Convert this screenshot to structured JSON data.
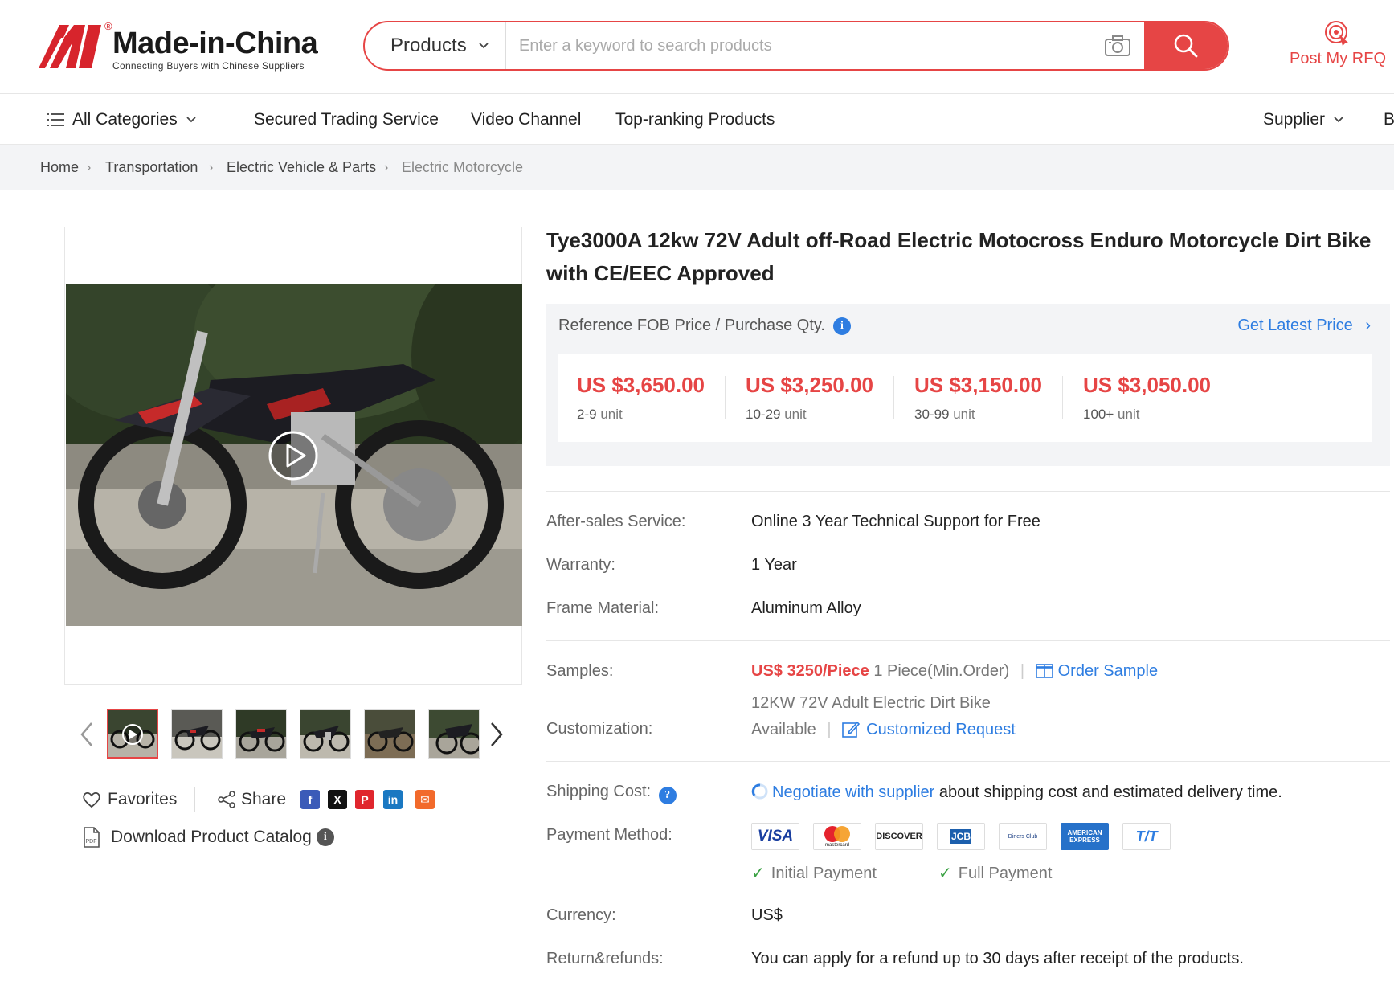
{
  "header": {
    "logo_text": "Made-in-China",
    "logo_reg": "®",
    "logo_sub": "Connecting Buyers with Chinese Suppliers",
    "search_type": "Products",
    "search_placeholder": "Enter a keyword to search products",
    "rfq_label": "Post My RFQ"
  },
  "nav": {
    "all_categories": "All Categories",
    "items": [
      "Secured Trading Service",
      "Video Channel",
      "Top-ranking Products"
    ],
    "supplier": "Supplier",
    "cut_item": "B"
  },
  "breadcrumb": [
    "Home",
    "Transportation",
    "Electric Vehicle & Parts",
    "Electric Motorcycle"
  ],
  "gallery": {
    "favorites": "Favorites",
    "share": "Share",
    "social": [
      "f",
      "X",
      "P",
      "in",
      "✉"
    ],
    "catalog": "Download Product Catalog",
    "pdf_label": "PDF"
  },
  "product": {
    "title": "Tye3000A 12kw 72V Adult off-Road Electric Motocross Enduro Motorcycle Dirt Bike with CE/EEC Approved",
    "price_header": "Reference FOB Price / Purchase Qty.",
    "get_latest": "Get Latest Price",
    "tiers": [
      {
        "price": "US $3,650.00",
        "qty": "2-9",
        "unit": "unit"
      },
      {
        "price": "US $3,250.00",
        "qty": "10-29",
        "unit": "unit"
      },
      {
        "price": "US $3,150.00",
        "qty": "30-99",
        "unit": "unit"
      },
      {
        "price": "US $3,050.00",
        "qty": "100+",
        "unit": "unit"
      }
    ],
    "specs": [
      {
        "label": "After-sales Service:",
        "value": "Online 3 Year Technical Support for Free"
      },
      {
        "label": "Warranty:",
        "value": "1 Year"
      },
      {
        "label": "Frame Material:",
        "value": "Aluminum Alloy"
      }
    ],
    "samples": {
      "label": "Samples:",
      "price": "US$ 3250/Piece",
      "moq": "1 Piece(Min.Order)",
      "action": "Order Sample"
    },
    "customization": {
      "label": "Customization:",
      "line1": "12KW 72V Adult Electric Dirt Bike",
      "available": "Available",
      "action": "Customized Request"
    },
    "shipping": {
      "label": "Shipping Cost:",
      "link": "Negotiate with supplier",
      "text": "about shipping cost and estimated delivery time."
    },
    "payment": {
      "label": "Payment Method:",
      "methods": [
        "VISA",
        "mastercard",
        "DISCOVER",
        "JCB",
        "Diners Club",
        "AMERICAN EXPRESS",
        "T/T"
      ],
      "terms": [
        "Initial Payment",
        "Full Payment"
      ]
    },
    "currency": {
      "label": "Currency:",
      "value": "US$"
    },
    "refunds": {
      "label": "Return&refunds:",
      "value": "You can apply for a refund up to 30 days after receipt of the products."
    }
  },
  "colors": {
    "accent": "#e64545",
    "link": "#2e7de1",
    "check": "#3aa143"
  }
}
